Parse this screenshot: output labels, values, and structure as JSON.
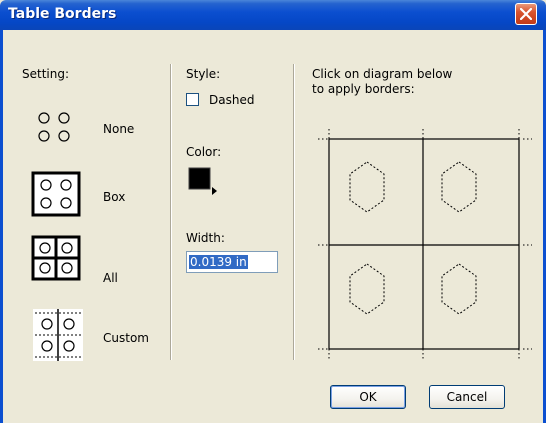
{
  "window": {
    "title": "Table Borders"
  },
  "setting": {
    "label": "Setting:",
    "options": [
      {
        "label": "None"
      },
      {
        "label": "Box"
      },
      {
        "label": "All"
      },
      {
        "label": "Custom"
      }
    ]
  },
  "style": {
    "label": "Style:",
    "dashed_label": "Dashed",
    "dashed_checked": false
  },
  "color": {
    "label": "Color:",
    "value": "#000000"
  },
  "width": {
    "label": "Width:",
    "value": "0.0139 in"
  },
  "diagram": {
    "instruction_line1": "Click on diagram below",
    "instruction_line2": "to apply borders:"
  },
  "buttons": {
    "ok": "OK",
    "cancel": "Cancel"
  },
  "colors": {
    "titlebar": "#0b4fd0",
    "dialog_bg": "#ece9d8",
    "close": "#d8542f"
  },
  "icons": [
    "close-icon",
    "color-picker-icon"
  ]
}
